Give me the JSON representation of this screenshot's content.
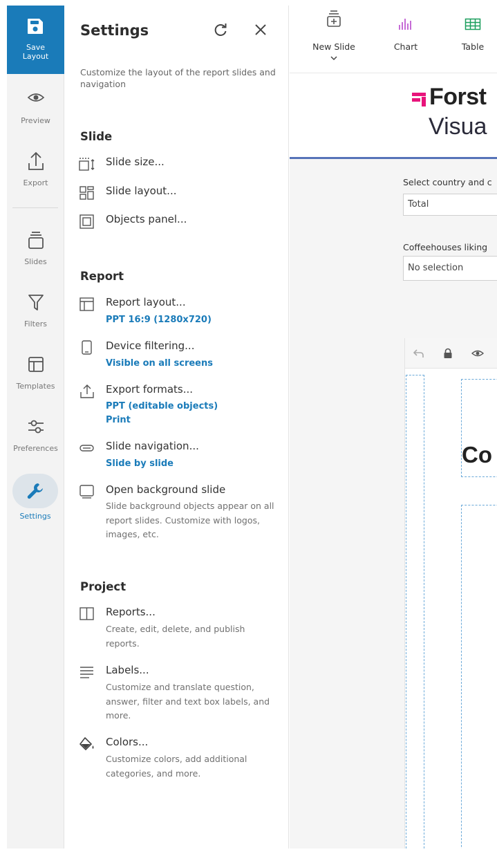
{
  "rail": {
    "save_label": "Save\nLayout",
    "items": [
      {
        "label": "Preview",
        "icon": "eye-icon"
      },
      {
        "label": "Export",
        "icon": "export-icon"
      },
      {
        "label": "Slides",
        "icon": "slides-icon"
      },
      {
        "label": "Filters",
        "icon": "filter-icon"
      },
      {
        "label": "Templates",
        "icon": "templates-icon"
      },
      {
        "label": "Preferences",
        "icon": "sliders-icon"
      }
    ],
    "settings_label": "Settings"
  },
  "panel": {
    "title": "Settings",
    "description": "Customize the layout of the report slides and navigation",
    "slide_section": {
      "title": "Slide",
      "items": [
        {
          "name": "Slide size...",
          "icon": "slide-size-icon"
        },
        {
          "name": "Slide layout...",
          "icon": "slide-layout-icon"
        },
        {
          "name": "Objects panel...",
          "icon": "objects-panel-icon"
        }
      ]
    },
    "report_section": {
      "title": "Report",
      "report_layout": {
        "name": "Report layout...",
        "value": "PPT 16:9 (1280x720)"
      },
      "device_filtering": {
        "name": "Device filtering...",
        "value": "Visible on all screens"
      },
      "export_formats": {
        "name": "Export formats...",
        "value_1": "PPT (editable objects)",
        "value_2": "Print"
      },
      "slide_navigation": {
        "name": "Slide navigation...",
        "value": "Slide by slide"
      },
      "background_slide": {
        "name": "Open background slide",
        "description": "Slide background objects appear on all report slides. Customize with logos, images, etc."
      }
    },
    "project_section": {
      "title": "Project",
      "reports": {
        "name": "Reports...",
        "description": "Create, edit, delete, and publish reports."
      },
      "labels": {
        "name": "Labels...",
        "description": "Customize and translate question, answer, filter and text box labels, and more."
      },
      "colors": {
        "name": "Colors...",
        "description": "Customize colors, add additional categories, and more."
      }
    }
  },
  "toolbar": {
    "new_slide": "New Slide",
    "chart": "Chart",
    "table": "Table"
  },
  "report": {
    "brand_line_1": "Forst",
    "brand_line_2": "Visua",
    "filter_1_label": "Select country and c",
    "filter_1_value": "Total",
    "filter_2_label": "Coffeehouses liking",
    "filter_2_value": "No selection",
    "slide_text": "Co"
  },
  "colors": {
    "accent": "#1a7bb9",
    "brand_pink": "#e8147b",
    "chart_purple": "#b23bc8",
    "table_green": "#1a9e5c",
    "header_rule": "#5673b8"
  }
}
